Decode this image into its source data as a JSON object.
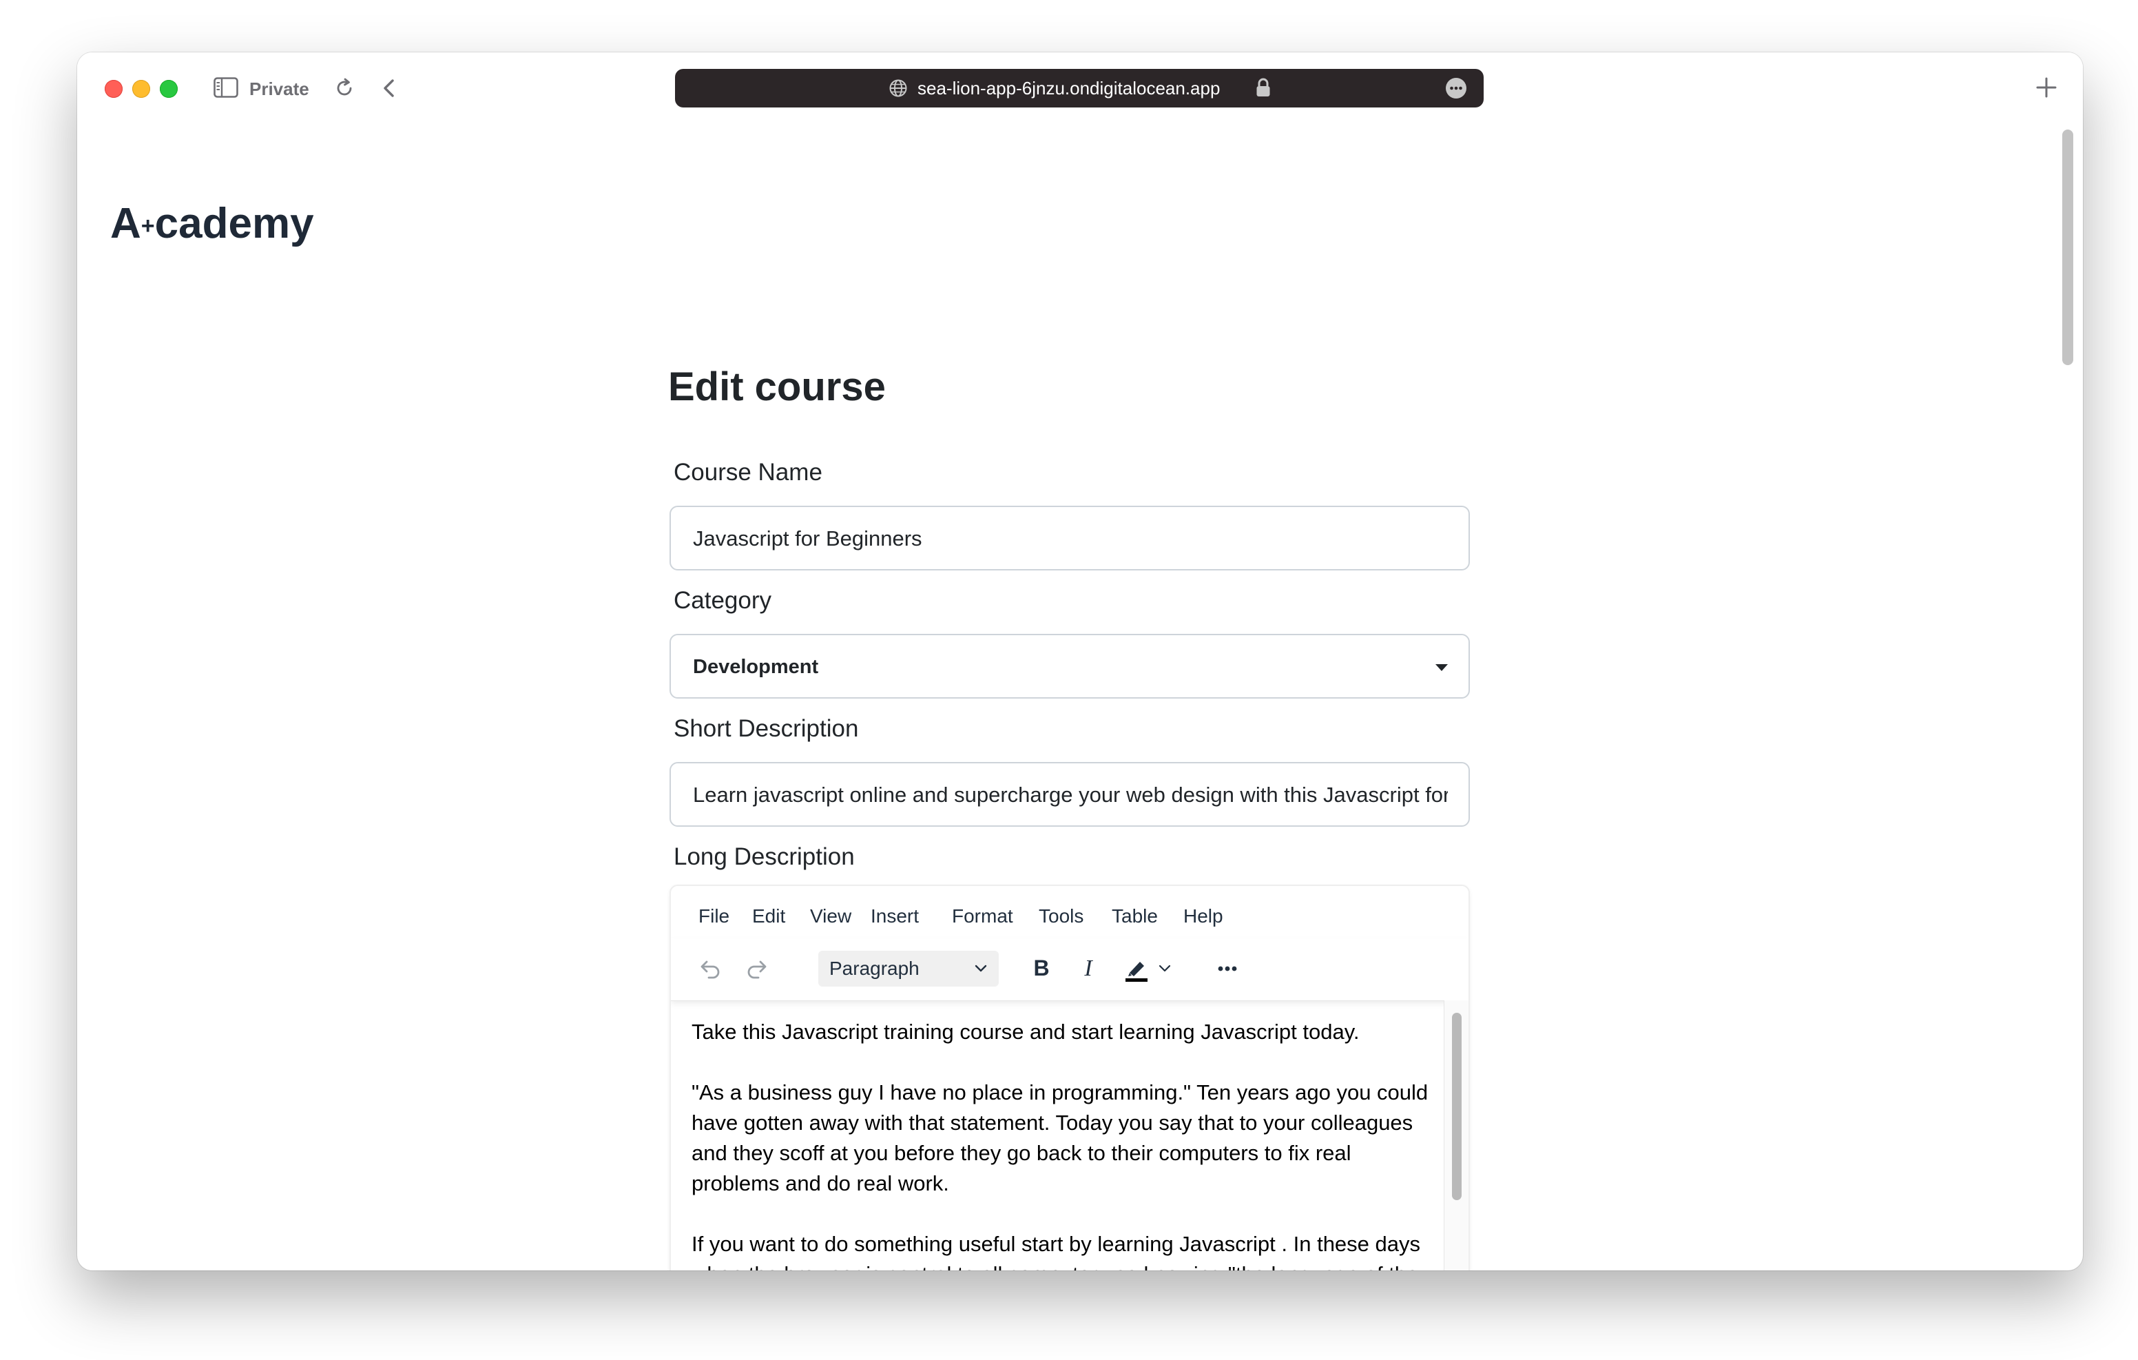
{
  "browser": {
    "private_label": "Private",
    "url": "sea-lion-app-6jnzu.ondigitalocean.app"
  },
  "site": {
    "logo_main": "A",
    "logo_plus": "+",
    "logo_rest": "cademy"
  },
  "form": {
    "title": "Edit course",
    "course_name_label": "Course Name",
    "course_name_value": "Javascript for Beginners",
    "category_label": "Category",
    "category_selected": "Development",
    "short_description_label": "Short Description",
    "short_description_value": "Learn javascript online and supercharge your web design with this Javascript for beginners training course.",
    "long_description_label": "Long Description"
  },
  "editor": {
    "menu": [
      "File",
      "Edit",
      "View",
      "Insert",
      "Format",
      "Tools",
      "Table",
      "Help"
    ],
    "block_format": "Paragraph",
    "toolbar_icons": [
      "undo-icon",
      "redo-icon",
      "bold-icon",
      "italic-icon",
      "highlight-color-icon",
      "chevron-down-icon",
      "more-icon"
    ],
    "paragraphs": [
      "Take this Javascript training course and start learning Javascript today.",
      "\"As a business guy I have no place in programming.\" Ten years ago you could have gotten away with that statement. Today you say that to your colleagues and they scoff at you before they go back to their computers to fix real problems and do real work.",
      "If you want to do something useful start by learning Javascript . In these days when the browser is central to all computer use knowing \"the language of the browser\" is the most important step. A few"
    ]
  },
  "colors": {
    "close": "#ff5f57",
    "minimize": "#febc2e",
    "maximize": "#28c840",
    "url_bar": "#2c2628",
    "heading": "#212529",
    "input_border": "#ced4da"
  }
}
